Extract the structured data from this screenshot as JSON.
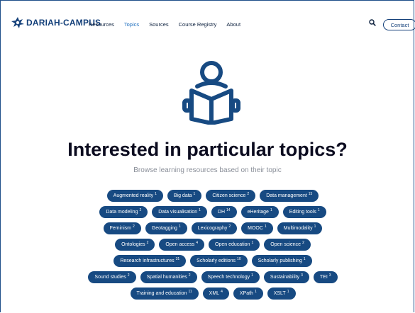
{
  "header": {
    "logo_text": "DARIAH-CAMPUS",
    "nav": [
      "Resources",
      "Topics",
      "Sources",
      "Course Registry",
      "About"
    ],
    "active_nav": "Topics",
    "contact_label": "Contact"
  },
  "hero": {
    "title": "Interested in particular topics?",
    "subtitle": "Browse learning resources based on their topic"
  },
  "tags": [
    [
      {
        "label": "Augmented reality",
        "count": "1"
      },
      {
        "label": "Big data",
        "count": "1"
      },
      {
        "label": "Citizen science",
        "count": "2"
      },
      {
        "label": "Data management",
        "count": "15"
      }
    ],
    [
      {
        "label": "Data modeling",
        "count": "2"
      },
      {
        "label": "Data visualisation",
        "count": "1"
      },
      {
        "label": "DH",
        "count": "14"
      },
      {
        "label": "eHeritage",
        "count": "1"
      },
      {
        "label": "Editing tools",
        "count": "1"
      }
    ],
    [
      {
        "label": "Feminism",
        "count": "2"
      },
      {
        "label": "Geotagging",
        "count": "1"
      },
      {
        "label": "Lexicography",
        "count": "2"
      },
      {
        "label": "MOOC",
        "count": "1"
      },
      {
        "label": "Multimodality",
        "count": "1"
      }
    ],
    [
      {
        "label": "Ontologies",
        "count": "2"
      },
      {
        "label": "Open access",
        "count": "4"
      },
      {
        "label": "Open education",
        "count": "1"
      },
      {
        "label": "Open science",
        "count": "2"
      }
    ],
    [
      {
        "label": "Research infrastructures",
        "count": "31"
      },
      {
        "label": "Scholarly editions",
        "count": "10"
      },
      {
        "label": "Scholarly publishing",
        "count": "1"
      }
    ],
    [
      {
        "label": "Sound studies",
        "count": "2"
      },
      {
        "label": "Spatial humanities",
        "count": "2"
      },
      {
        "label": "Speech technology",
        "count": "1"
      },
      {
        "label": "Sustainability",
        "count": "3"
      },
      {
        "label": "TEI",
        "count": "3"
      }
    ],
    [
      {
        "label": "Training and education",
        "count": "11"
      },
      {
        "label": "XML",
        "count": "4"
      },
      {
        "label": "XPath",
        "count": "1"
      },
      {
        "label": "XSLT",
        "count": "1"
      }
    ]
  ],
  "icons": {
    "search": "search-icon",
    "hero": "reader-icon",
    "logo": "dariah-logo-icon"
  },
  "colors": {
    "brand": "#174a82",
    "active_nav": "#1f6fbf",
    "subtitle": "#8a8f99"
  }
}
